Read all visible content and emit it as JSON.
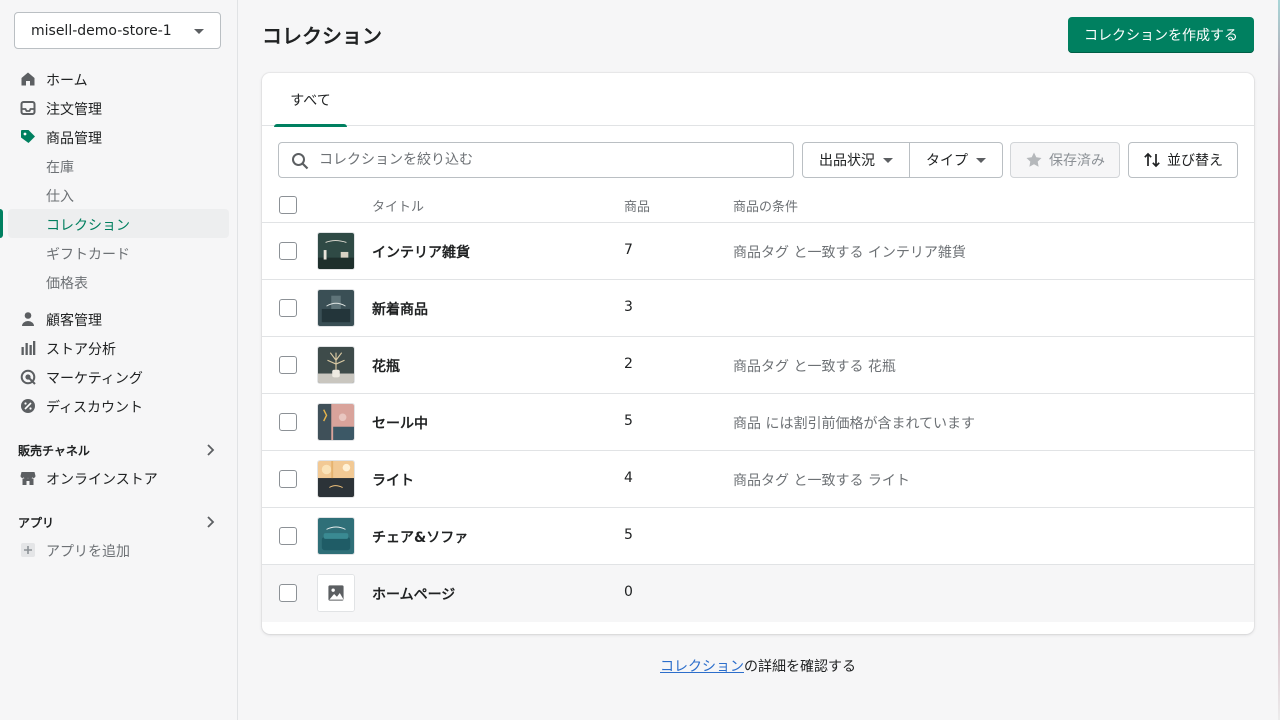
{
  "store": {
    "name": "misell-demo-store-1"
  },
  "nav": {
    "home": "ホーム",
    "orders": "注文管理",
    "products": "商品管理",
    "inventory": "在庫",
    "transfers": "仕入",
    "collections": "コレクション",
    "gift_cards": "ギフトカード",
    "price_lists": "価格表",
    "customers": "顧客管理",
    "analytics": "ストア分析",
    "marketing": "マーケティング",
    "discounts": "ディスカウント"
  },
  "sales_channels": {
    "heading": "販売チャネル",
    "online_store": "オンラインストア"
  },
  "apps": {
    "heading": "アプリ",
    "add": "アプリを追加"
  },
  "header": {
    "title": "コレクション",
    "create_button": "コレクションを作成する"
  },
  "tabs": [
    {
      "label": "すべて"
    }
  ],
  "filters": {
    "search_placeholder": "コレクションを絞り込む",
    "status": "出品状況",
    "type": "タイプ",
    "saved": "保存済み",
    "sort": "並び替え"
  },
  "table": {
    "columns": {
      "title": "タイトル",
      "products": "商品",
      "conditions": "商品の条件"
    },
    "rows": [
      {
        "title": "インテリア雑貨",
        "count": "7",
        "condition": "商品タグ と一致する インテリア雑貨"
      },
      {
        "title": "新着商品",
        "count": "3",
        "condition": ""
      },
      {
        "title": "花瓶",
        "count": "2",
        "condition": "商品タグ と一致する 花瓶"
      },
      {
        "title": "セール中",
        "count": "5",
        "condition": "商品 には割引前価格が含まれています"
      },
      {
        "title": "ライト",
        "count": "4",
        "condition": "商品タグ と一致する ライト"
      },
      {
        "title": "チェア&ソファ",
        "count": "5",
        "condition": ""
      },
      {
        "title": "ホームページ",
        "count": "0",
        "condition": ""
      }
    ]
  },
  "footer": {
    "link": "コレクション",
    "suffix": "の詳細を確認する"
  },
  "colors": {
    "accent": "#008060",
    "link": "#2c6ecb",
    "muted": "#6d7175"
  }
}
